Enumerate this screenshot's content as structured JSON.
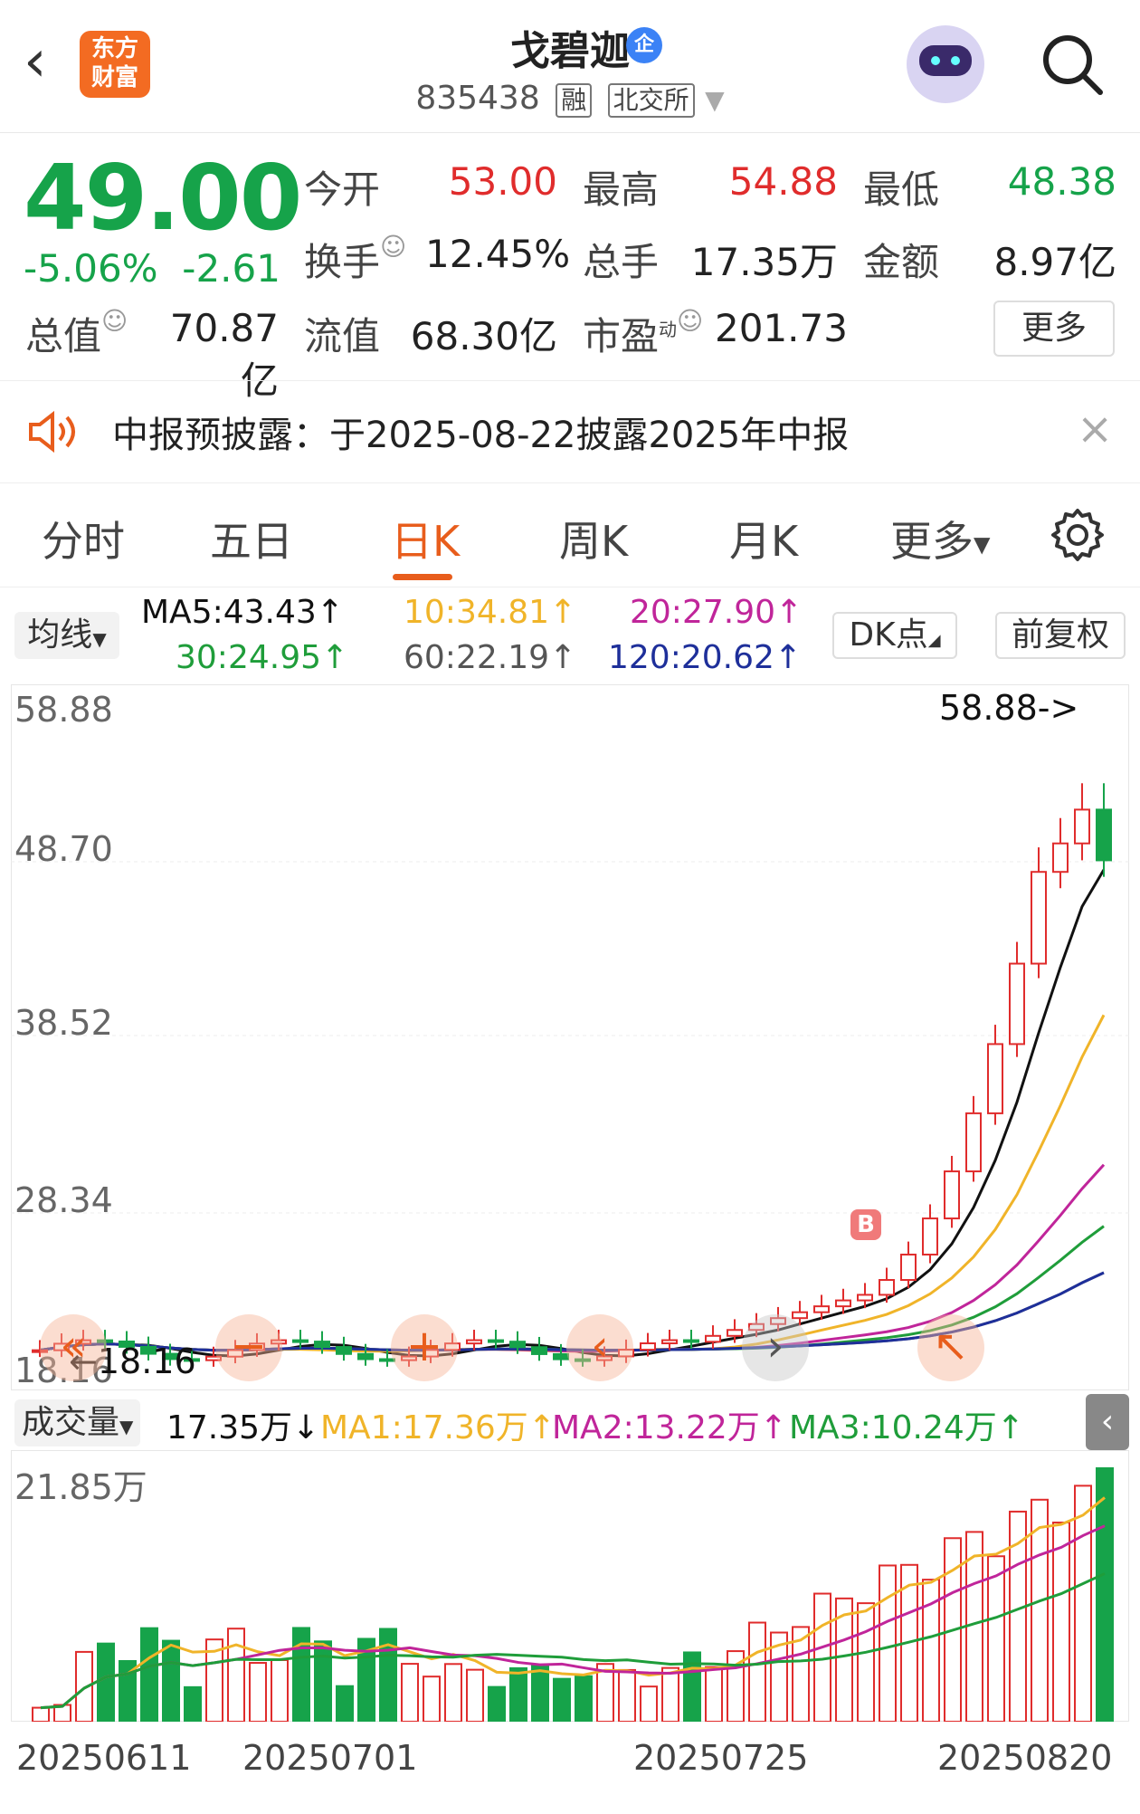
{
  "header": {
    "back_icon": "chevron-left-icon",
    "logo_line1": "东方",
    "logo_line2": "财富",
    "title": "戈碧迦",
    "title_badge": "企",
    "code": "835438",
    "tag_margin": "融",
    "tag_exchange": "北交所"
  },
  "quote": {
    "price": "49.00",
    "change_pct": "-5.06%",
    "change_amt": "-2.61",
    "open_label": "今开",
    "open": "53.00",
    "high_label": "最高",
    "high": "54.88",
    "low_label": "最低",
    "low": "48.38",
    "turnover_label": "换手",
    "turnover": "12.45%",
    "volume_label": "总手",
    "volume": "17.35万",
    "amount_label": "金额",
    "amount": "8.97亿",
    "mktcap_label": "总值",
    "mktcap": "70.87亿",
    "float_label": "流值",
    "float": "68.30亿",
    "pe_label": "市盈",
    "pe_sup": "动",
    "pe": "201.73",
    "more": "更多"
  },
  "notice": {
    "text": "中报预披露：于2025-08-22披露2025年中报"
  },
  "tabs": [
    {
      "label": "分时"
    },
    {
      "label": "五日"
    },
    {
      "label": "日K"
    },
    {
      "label": "周K"
    },
    {
      "label": "月K"
    },
    {
      "label": "更多"
    }
  ],
  "ma": {
    "select": "均线",
    "ma5": "MA5:43.43↑",
    "ma10": "10:34.81↑",
    "ma20": "20:27.90↑",
    "ma30": "30:24.95↑",
    "ma60": "60:22.19↑",
    "ma120": "120:20.62↑",
    "dk": "DK点",
    "fq": "前复权"
  },
  "kchart": {
    "y_labels": [
      "58.88",
      "48.70",
      "38.52",
      "28.34",
      "18.16"
    ],
    "max_marker": "58.88->",
    "min_marker": "←18.16",
    "buy_marker": "B"
  },
  "volume": {
    "select": "成交量",
    "value": "17.35万↓",
    "ma1": "MA1:17.36万↑",
    "ma2": "MA2:13.22万↑",
    "ma3": "MA3:10.24万↑",
    "max_label": "21.85万"
  },
  "dates": [
    "20250611",
    "20250701",
    "20250725",
    "20250820"
  ],
  "colors": {
    "up": "#e02c2c",
    "down": "#16a34a",
    "accent": "#e85d1c",
    "ma5": "#111111",
    "ma10": "#f0b429",
    "ma20": "#c0259a",
    "ma30": "#1f9d3a",
    "ma60": "#666666",
    "ma120": "#1e2f9a"
  }
}
